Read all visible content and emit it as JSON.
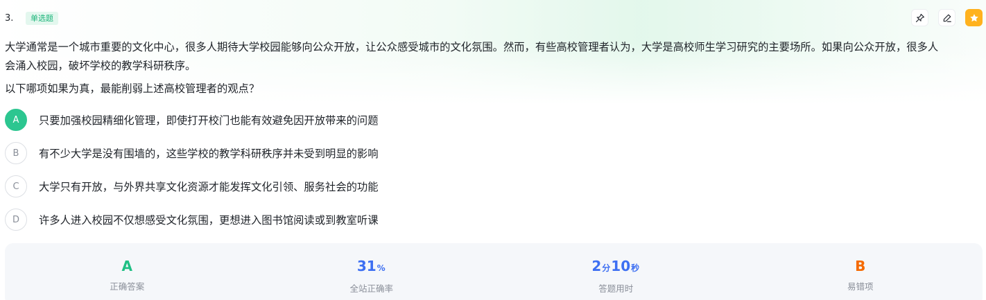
{
  "question": {
    "number": "3.",
    "type_badge": "单选题",
    "stem_line1": "大学通常是一个城市重要的文化中心，很多人期待大学校园能够向公众开放，让公众感受城市的文化氛围。然而，有些高校管理者认为，大学是高校师生学习研究的主要场所。如果向公众开放，很多人",
    "stem_line2": "会涌入校园，破坏学校的教学科研秩序。",
    "prompt": "以下哪项如果为真，最能削弱上述高校管理者的观点？"
  },
  "toolbar": {
    "icons": [
      "pin-icon",
      "edit-icon",
      "star-icon"
    ],
    "accent_color": "#ffb21e"
  },
  "options": [
    {
      "letter": "A",
      "text": "只要加强校园精细化管理，即使打开校门也能有效避免因开放带来的问题",
      "selected": true
    },
    {
      "letter": "B",
      "text": "有不少大学是没有围墙的，这些学校的教学科研秩序并未受到明显的影响",
      "selected": false
    },
    {
      "letter": "C",
      "text": "大学只有开放，与外界共享文化资源才能发挥文化引领、服务社会的功能",
      "selected": false
    },
    {
      "letter": "D",
      "text": "许多人进入校园不仅想感受文化氛围，更想进入图书馆阅读或到教室听课",
      "selected": false
    }
  ],
  "stats": {
    "correct_answer": {
      "value": "A",
      "label": "正确答案"
    },
    "accuracy": {
      "value": "31",
      "unit": "%",
      "label": "全站正确率"
    },
    "time": {
      "minutes": "2",
      "min_unit": "分",
      "seconds": "10",
      "sec_unit": "秒",
      "label": "答题用时"
    },
    "common_mistake": {
      "value": "B",
      "label": "易错项"
    }
  },
  "colors": {
    "correct": "#1fbf84",
    "accuracy": "#3d6ff2",
    "mistake": "#f56a00",
    "selected_option": "#2cc690"
  }
}
